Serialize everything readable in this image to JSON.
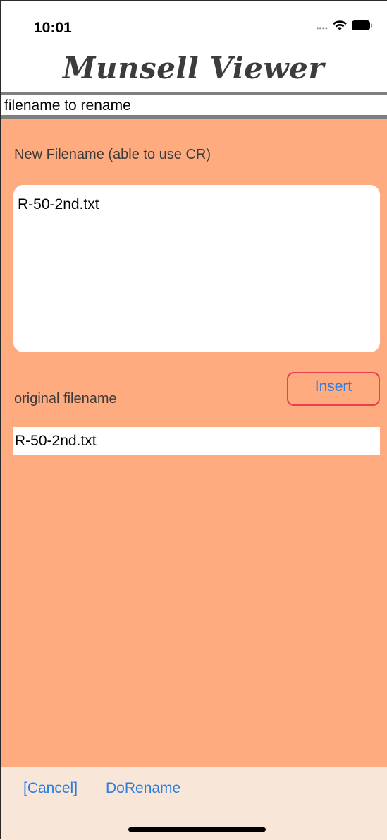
{
  "status_bar": {
    "time": "10:01",
    "signal_icon": "cellular-dots-icon",
    "wifi_icon": "wifi-icon",
    "battery_icon": "battery-icon"
  },
  "app": {
    "title": "Munsell Viewer"
  },
  "header": {
    "label": "filename to rename"
  },
  "form": {
    "new_filename_label": "New Filename (able to use CR)",
    "new_filename_value": "R-50-2nd.txt",
    "insert_label": "Insert",
    "original_label": "original filename",
    "original_value": "R-50-2nd.txt"
  },
  "toolbar": {
    "cancel_label": "[Cancel]",
    "rename_label": "DoRename"
  },
  "colors": {
    "background": "#ffab80",
    "toolbar": "#f8e6d8",
    "accent": "#2d7de0",
    "insert_border": "#e8404e",
    "rule": "#7e7e7e"
  }
}
